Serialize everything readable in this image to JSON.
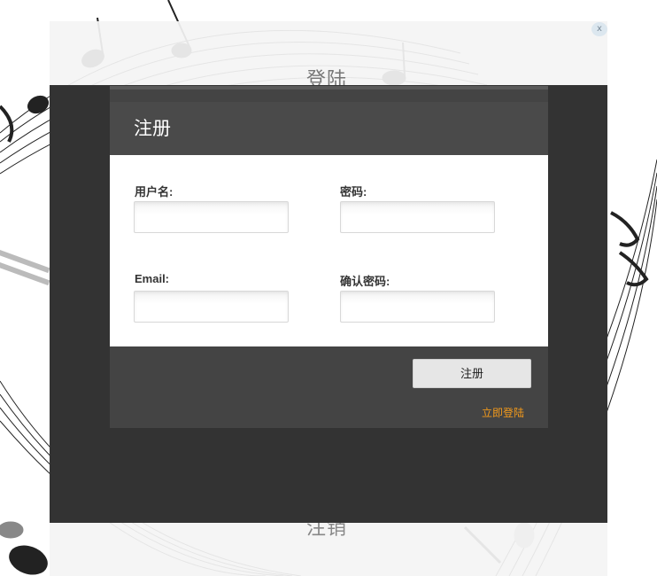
{
  "background": {
    "login_label": "登陆",
    "logout_label": "注销",
    "close_label": "x"
  },
  "dialog": {
    "title": "注册",
    "fields": {
      "username_label": "用户名:",
      "password_label": "密码:",
      "email_label": "Email:",
      "confirm_label": "确认密码:"
    },
    "register_button": "注册",
    "login_now_link": "立即登陆"
  },
  "colors": {
    "overlay": "#333333",
    "dialog": "#444444",
    "link_accent": "#f39a1b"
  }
}
